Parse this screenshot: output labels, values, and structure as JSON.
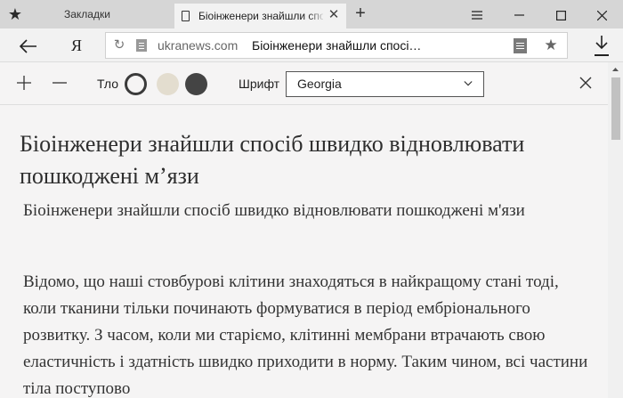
{
  "tabs": {
    "bookmarks_label": "Закладки",
    "active_title": "Біоінженери знайшли спосіб швидко відновлювати пошкоджені м’язи"
  },
  "address_bar": {
    "yandex_label": "Я",
    "domain": "ukranews.com",
    "page_title": "Біоінженери знайшли спосі…"
  },
  "reader_toolbar": {
    "background_label": "Тло",
    "font_label": "Шрифт",
    "font_value": "Georgia",
    "background_options": [
      "#f5f4f4",
      "#e3ddcf",
      "#444444"
    ]
  },
  "article": {
    "title": "Біоінженери знайшли спосіб швидко відновлювати пошкоджені м’язи",
    "subtitle": "Біоінженери знайшли спосіб швидко відновлювати пошкоджені м'язи",
    "body": "Відомо, що наші стовбурові клітини знаходяться в найкращому стані тоді, коли тканини тільки починають формуватися в період ембріонального розвитку. З часом, коли ми старіємо, клітинні мембрани втрачають свою еластичність і здатність швидко приходити в норму. Таким чином, всі частини тіла поступово"
  },
  "icons": {
    "bookmarks_tab": "star-icon",
    "page": "page-icon",
    "tab_close": "close-icon",
    "new_tab": "plus-icon",
    "menu": "hamburger-icon",
    "minimize": "minimize-icon",
    "maximize": "maximize-icon",
    "window_close": "close-icon",
    "back": "arrow-left-icon",
    "reload": "reload-icon",
    "reader_mode": "reader-icon",
    "bookmark": "star-icon",
    "download": "download-icon",
    "font_increase": "plus-icon",
    "font_decrease": "minus-icon",
    "reader_close": "close-icon"
  }
}
